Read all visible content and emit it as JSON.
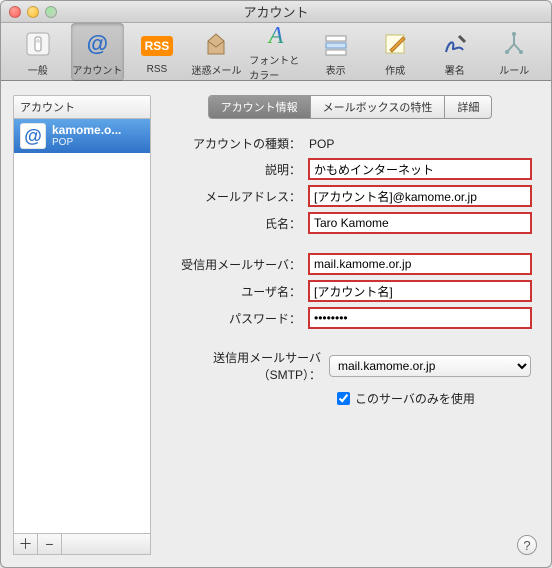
{
  "window": {
    "title": "アカウント"
  },
  "toolbar": {
    "general": "一般",
    "account": "アカウント",
    "rss": "RSS",
    "junk": "迷惑メール",
    "fonts": "フォントとカラー",
    "view": "表示",
    "compose": "作成",
    "signature": "署名",
    "rules": "ルール"
  },
  "sidebar": {
    "header": "アカウント",
    "items": [
      {
        "name": "kamome.o...",
        "type": "POP"
      }
    ],
    "add": "＋",
    "remove": "−"
  },
  "tabs": {
    "info": "アカウント情報",
    "mailbox": "メールボックスの特性",
    "detail": "詳細"
  },
  "form": {
    "account_type_label": "アカウントの種類：",
    "account_type_value": "POP",
    "description_label": "説明：",
    "description_value": "かもめインターネット",
    "email_label": "メールアドレス：",
    "email_value": "[アカウント名]@kamome.or.jp",
    "name_label": "氏名：",
    "name_value": "Taro Kamome",
    "incoming_label": "受信用メールサーバ：",
    "incoming_value": "mail.kamome.or.jp",
    "user_label": "ユーザ名：",
    "user_value": "[アカウント名]",
    "password_label": "パスワード：",
    "password_value": "••••••••",
    "smtp_label": "送信用メールサーバ（SMTP）：",
    "smtp_value": "mail.kamome.or.jp",
    "only_server_label": "このサーバのみを使用"
  }
}
